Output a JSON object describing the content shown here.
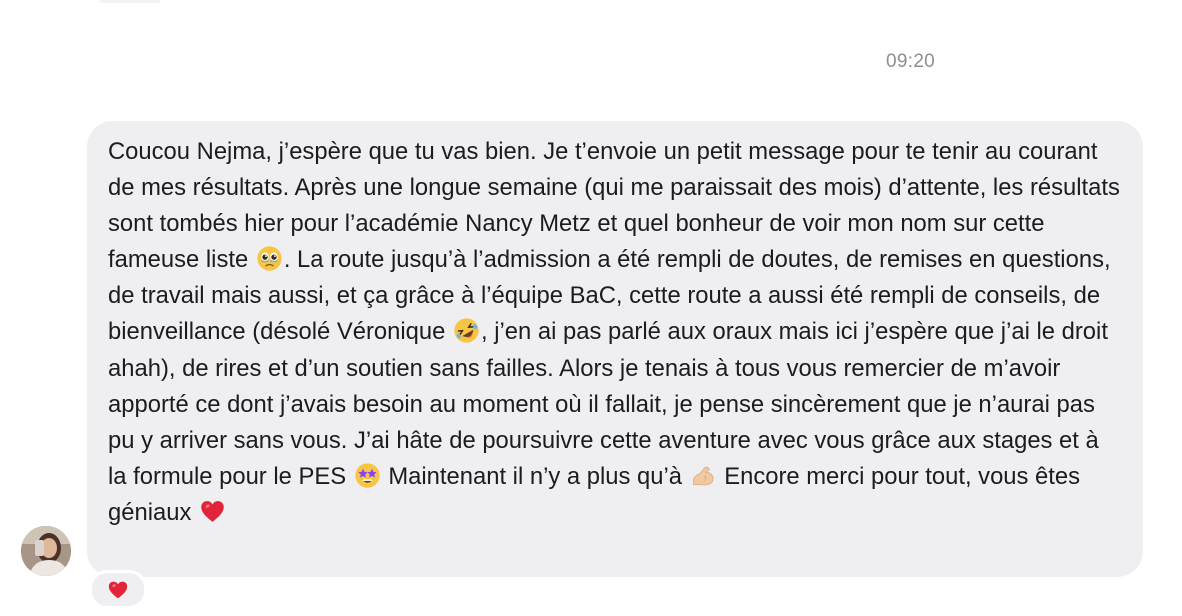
{
  "conversation": {
    "timestamp": "09:20"
  },
  "message": {
    "parts": [
      "Coucou Nejma, j’espère que tu vas bien. Je t’envoie un petit message pour te tenir au courant de mes résultats. Après une longue semaine (qui me paraissait des mois) d’attente, les résultats sont tombés hier pour l’académie Nancy Metz et quel bonheur de voir mon nom sur cette fameuse liste ",
      ". La route jusqu’à l’admission a été rempli de doutes, de remises en questions, de travail mais aussi, et ça grâce à l’équipe BaC, cette route a aussi été rempli de conseils, de bienveillance (désolé Véronique ",
      ", j’en ai pas parlé aux oraux mais ici j’espère que j’ai le droit ahah), de rires et d’un soutien sans failles. Alors je tenais à tous vous remercier de m’avoir apporté ce dont j’avais besoin au moment où il fallait, je pense sincèrement que je n’aurai pas pu y arriver sans vous. J’ai hâte de poursuivre cette aventure avec vous grâce aux stages et à la formule pour le PES ",
      " Maintenant il n’y a plus qu’à ",
      " Encore merci pour tout, vous êtes géniaux "
    ],
    "emojis": [
      "holding-back-tears-emoji",
      "rolling-laughing-emoji",
      "star-struck-emoji",
      "flexed-biceps-emoji",
      "red-heart-emoji"
    ]
  },
  "reaction": {
    "icon": "red-heart-icon"
  },
  "avatar": {
    "icon": "user-photo-avatar"
  },
  "colors": {
    "bubble": "#efeff1",
    "text": "#1c1c1e",
    "timestamp": "#8e8e93",
    "heart": "#e0243a"
  }
}
